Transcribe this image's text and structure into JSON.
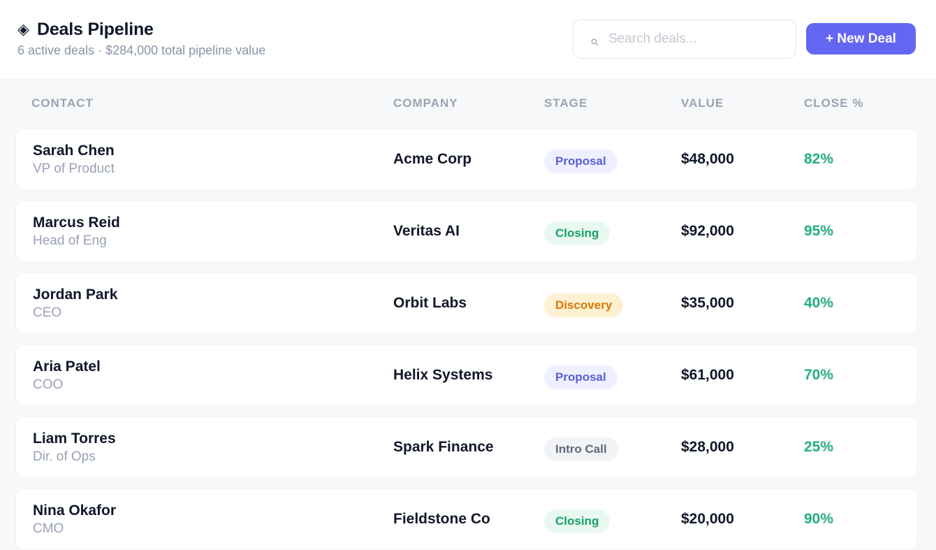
{
  "header": {
    "title": "Deals Pipeline",
    "title_icon": "◈",
    "subtitle": "6 active deals · $284,000 total pipeline value",
    "search_placeholder": "Search deals...",
    "search_icon": "⚲",
    "new_deal_label": "+ New Deal"
  },
  "columns": {
    "contact": "CONTACT",
    "company": "COMPANY",
    "stage": "STAGE",
    "value": "VALUE",
    "close": "CLOSE %"
  },
  "stage_colors": {
    "Proposal": {
      "bg": "#eef0ff",
      "fg": "#5b5fd6"
    },
    "Closing": {
      "bg": "#e9f9f1",
      "fg": "#16a06b"
    },
    "Discovery": {
      "bg": "#fdf1d2",
      "fg": "#d97706"
    },
    "Intro Call": {
      "bg": "#f1f3f6",
      "fg": "#5f6b7a"
    }
  },
  "deals": [
    {
      "name": "Sarah Chen",
      "role": "VP of Product",
      "company": "Acme Corp",
      "stage": "Proposal",
      "value": "$48,000",
      "close": "82%"
    },
    {
      "name": "Marcus Reid",
      "role": "Head of Eng",
      "company": "Veritas AI",
      "stage": "Closing",
      "value": "$92,000",
      "close": "95%"
    },
    {
      "name": "Jordan Park",
      "role": "CEO",
      "company": "Orbit Labs",
      "stage": "Discovery",
      "value": "$35,000",
      "close": "40%"
    },
    {
      "name": "Aria Patel",
      "role": "COO",
      "company": "Helix Systems",
      "stage": "Proposal",
      "value": "$61,000",
      "close": "70%"
    },
    {
      "name": "Liam Torres",
      "role": "Dir. of Ops",
      "company": "Spark Finance",
      "stage": "Intro Call",
      "value": "$28,000",
      "close": "25%"
    },
    {
      "name": "Nina Okafor",
      "role": "CMO",
      "company": "Fieldstone Co",
      "stage": "Closing",
      "value": "$20,000",
      "close": "90%"
    }
  ]
}
